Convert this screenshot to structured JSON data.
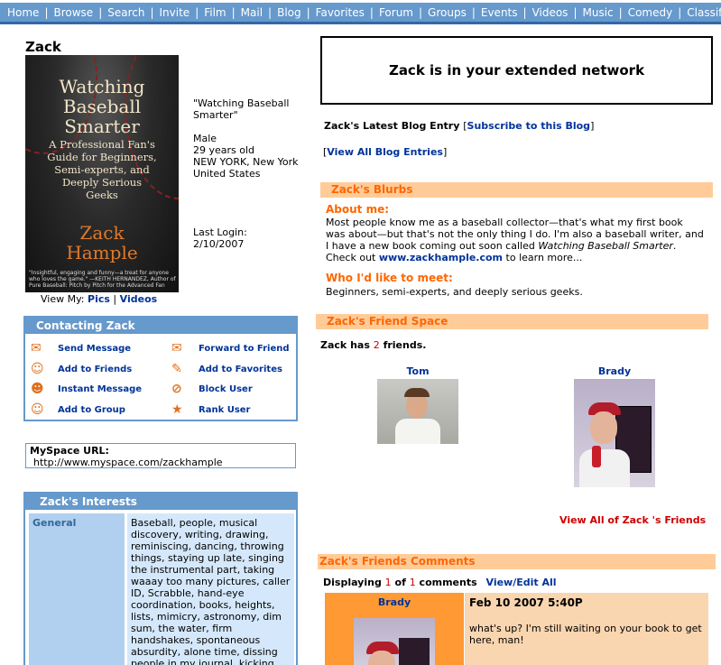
{
  "nav": {
    "items": [
      "Home",
      "Browse",
      "Search",
      "Invite",
      "Film",
      "Mail",
      "Blog",
      "Favorites",
      "Forum",
      "Groups",
      "Events",
      "Videos",
      "Music",
      "Comedy",
      "Classifieds"
    ]
  },
  "profile": {
    "name": "Zack",
    "book_cover": {
      "title": "Watching Baseball Smarter",
      "subtitle": "A Professional Fan's Guide for Beginners, Semi-experts, and Deeply Serious Geeks",
      "author": "Zack Hample",
      "blurb": "\"Insightful, engaging and funny—a treat for anyone who loves the game.\" —KEITH HERNANDEZ, Author of Pure Baseball: Pitch by Pitch for the Advanced Fan"
    },
    "headline": "\"Watching Baseball Smarter\"",
    "gender": "Male",
    "age": "29 years old",
    "city": "NEW YORK, New York",
    "country": "United States",
    "last_login_label": "Last Login:",
    "last_login": "2/10/2007",
    "view_my_label": "View My:",
    "pics_link": "Pics",
    "videos_link": "Videos",
    "separator": "|"
  },
  "contact": {
    "title": "Contacting Zack",
    "items": [
      {
        "label": "Send Message",
        "icon": "envelope-icon"
      },
      {
        "label": "Forward to Friend",
        "icon": "forward-envelope-icon"
      },
      {
        "label": "Add to Friends",
        "icon": "add-friend-icon"
      },
      {
        "label": "Add to Favorites",
        "icon": "favorites-icon"
      },
      {
        "label": "Instant Message",
        "icon": "instant-message-icon"
      },
      {
        "label": "Block User",
        "icon": "block-user-icon"
      },
      {
        "label": "Add to Group",
        "icon": "add-group-icon"
      },
      {
        "label": "Rank User",
        "icon": "rank-user-icon"
      }
    ]
  },
  "myspace_url": {
    "label": "MySpace URL:",
    "value": "http://www.myspace.com/zackhample"
  },
  "interests": {
    "title": "Zack's Interests",
    "category": "General",
    "text": "Baseball, people, musical discovery, writing, drawing, reminiscing, dancing, throwing things, staying up late, singing the instrumental part, taking waaay too many pictures, caller ID, Scrabble, hand-eye coordination, books, heights, lists, mimicry, astronomy, dim sum, the water, firm handshakes, spontaneous absurdity, alone time, dissing people in my journal, kicking"
  },
  "network": {
    "text": "Zack is in your extended network"
  },
  "blog": {
    "latest_label": "Zack's Latest Blog Entry",
    "subscribe_link": "Subscribe to this Blog",
    "view_all_link": "View All Blog Entries",
    "open_bracket": "[",
    "close_bracket": "]"
  },
  "blurbs": {
    "title": "Zack's Blurbs",
    "about_heading": "About me:",
    "about_text_1": "Most people know me as a baseball collector—that's what my first book was about—but that's not the only thing I do. I'm also a baseball writer, and I have a new book coming out soon called ",
    "about_book": "Watching Baseball Smarter",
    "about_text_2": ". Check out ",
    "about_link": "www.zackhample.com",
    "about_text_3": " to learn more...",
    "meet_heading": "Who I'd like to meet:",
    "meet_text": "Beginners, semi-experts, and deeply serious geeks."
  },
  "friends": {
    "title": "Zack's Friend Space",
    "count_prefix": "Zack has",
    "count": "2",
    "count_suffix": "friends.",
    "list": [
      {
        "name": "Tom"
      },
      {
        "name": "Brady"
      }
    ],
    "view_all": "View All of Zack 's Friends"
  },
  "comments": {
    "title": "Zack's Friends Comments",
    "displaying_label": "Displaying",
    "shown": "1",
    "of_label": "of",
    "total": "1",
    "comments_label": "comments",
    "edit_link": "View/Edit All",
    "items": [
      {
        "author": "Brady",
        "date": "Feb 10 2007 5:40P",
        "text": "what's up? I'm still waiting on your book to get here, man!"
      }
    ]
  },
  "colors": {
    "nav_bg": "#6699cc",
    "section_bar": "#ffcc99",
    "section_text": "#ff6600",
    "link": "#003399",
    "accent_red": "#cc0000"
  }
}
